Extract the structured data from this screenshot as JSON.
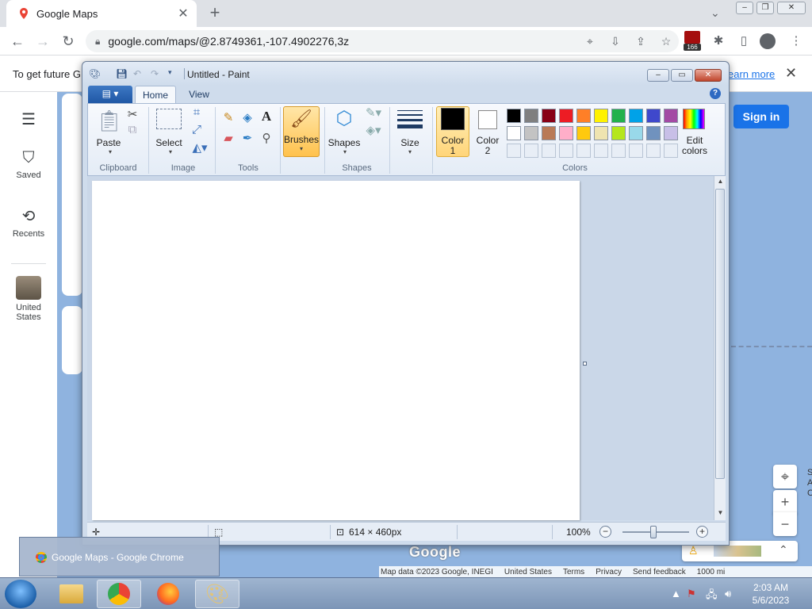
{
  "browser": {
    "tab_title": "Google Maps",
    "new_tab": "+",
    "url": "google.com/maps/@2.8749361,-107.4902276,3z",
    "extension_badge": "166",
    "infobar_message": "To get future G",
    "infobar_link": "earn more"
  },
  "maps": {
    "rail": {
      "saved": "Saved",
      "recents": "Recents",
      "place_line1": "United",
      "place_line2": "States"
    },
    "sign_in": "Sign in",
    "logo": "Google",
    "footer": [
      "Map data ©2023 Google, INEGI",
      "United States",
      "Terms",
      "Privacy",
      "Send feedback",
      "1000 mi"
    ],
    "edge_letters": [
      "S",
      "A",
      "C"
    ]
  },
  "paint": {
    "window_title": "Untitled - Paint",
    "tabs": [
      "Home",
      "View"
    ],
    "ribbon": {
      "paste": "Paste",
      "select": "Select",
      "brushes": "Brushes",
      "shapes": "Shapes",
      "size": "Size",
      "color1_line1": "Color",
      "color1_line2": "1",
      "color2_line1": "Color",
      "color2_line2": "2",
      "edit_colors_line1": "Edit",
      "edit_colors_line2": "colors",
      "groups": [
        "Clipboard",
        "Image",
        "Tools",
        "Shapes",
        "Colors"
      ]
    },
    "palette": [
      "#000000",
      "#7f7f7f",
      "#880015",
      "#ed1c24",
      "#ff7f27",
      "#fff200",
      "#22b14c",
      "#00a2e8",
      "#3f48cc",
      "#a349a4",
      "#ffffff",
      "#c3c3c3",
      "#b97a57",
      "#ffaec9",
      "#ffc90e",
      "#efe4b0",
      "#b5e61d",
      "#99d9ea",
      "#7092be",
      "#c8bfe7"
    ],
    "color1": "#000000",
    "color2": "#ffffff",
    "status": {
      "image_size": "614 × 460px",
      "zoom": "100%"
    }
  },
  "taskbar": {
    "thumbnail_title": "Google Maps - Google Chrome",
    "time": "2:03 AM",
    "date": "5/6/2023"
  }
}
